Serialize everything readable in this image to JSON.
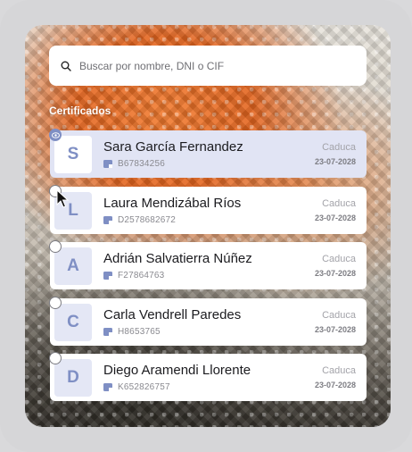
{
  "search": {
    "placeholder": "Buscar por nombre, DNI o CIF",
    "icon": "search-icon"
  },
  "section_title": "Certificados",
  "colors": {
    "accent": "#7f8fc4",
    "selected_bg": "#e1e4f4",
    "avatar_bg": "#e4e7f5"
  },
  "certificates": [
    {
      "initial": "S",
      "name": "Sara García Fernandez",
      "doc": "B67834256",
      "exp_label": "Caduca",
      "exp_date": "23-07-2028",
      "selected": true
    },
    {
      "initial": "L",
      "name": "Laura Mendizábal Ríos",
      "doc": "D2578682672",
      "exp_label": "Caduca",
      "exp_date": "23-07-2028",
      "selected": false
    },
    {
      "initial": "A",
      "name": "Adrián Salvatierra Núñez",
      "doc": "F27864763",
      "exp_label": "Caduca",
      "exp_date": "23-07-2028",
      "selected": false
    },
    {
      "initial": "C",
      "name": "Carla Vendrell Paredes",
      "doc": "H8653765",
      "exp_label": "Caduca",
      "exp_date": "23-07-2028",
      "selected": false
    },
    {
      "initial": "D",
      "name": "Diego Aramendi Llorente",
      "doc": "K652826757",
      "exp_label": "Caduca",
      "exp_date": "23-07-2028",
      "selected": false
    }
  ]
}
